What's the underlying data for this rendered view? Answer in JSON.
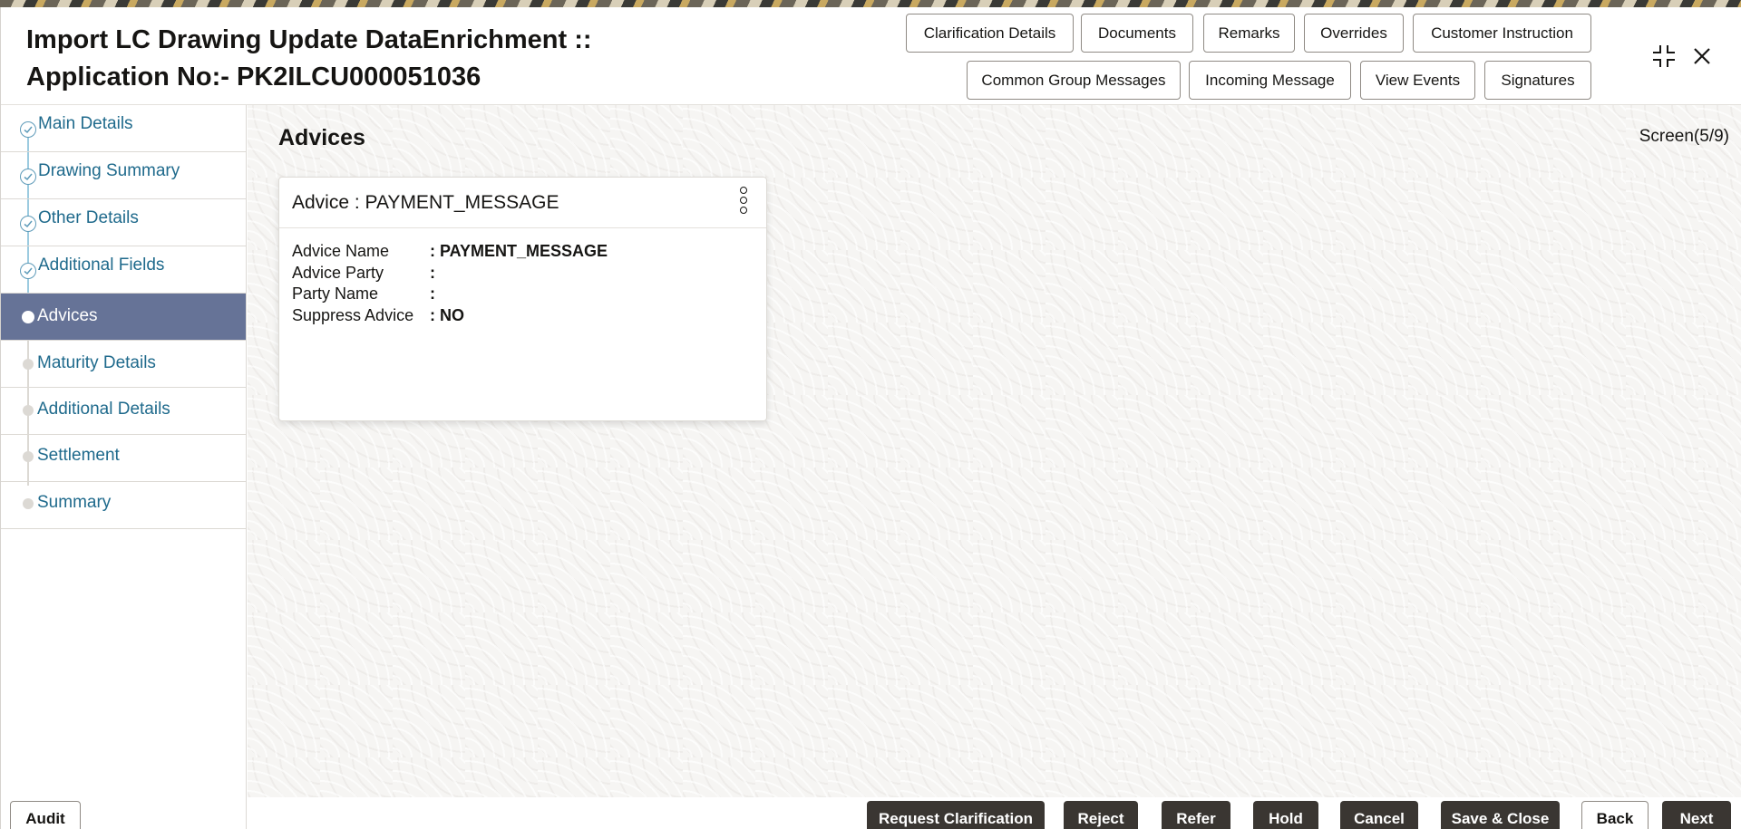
{
  "header": {
    "title_line1": "Import LC Drawing Update DataEnrichment ::",
    "title_line2": "Application No:- PK2ILCU000051036",
    "buttons_row1": [
      "Clarification Details",
      "Documents",
      "Remarks",
      "Overrides",
      "Customer Instruction"
    ],
    "buttons_row2": [
      "Common Group Messages",
      "Incoming Message",
      "View Events",
      "Signatures"
    ]
  },
  "sidebar": {
    "items": [
      {
        "label": "Main Details",
        "state": "completed"
      },
      {
        "label": "Drawing Summary",
        "state": "completed"
      },
      {
        "label": "Other Details",
        "state": "completed"
      },
      {
        "label": "Additional Fields",
        "state": "completed"
      },
      {
        "label": "Advices",
        "state": "active"
      },
      {
        "label": "Maturity Details",
        "state": "pending"
      },
      {
        "label": "Additional Details",
        "state": "pending"
      },
      {
        "label": "Settlement",
        "state": "pending"
      },
      {
        "label": "Summary",
        "state": "pending"
      }
    ]
  },
  "main": {
    "section_title": "Advices",
    "screen_indicator": "Screen(5/9)",
    "card": {
      "title": "Advice : PAYMENT_MESSAGE",
      "fields": [
        {
          "label": "Advice Name",
          "value": ": PAYMENT_MESSAGE"
        },
        {
          "label": "Advice Party",
          "value": ":"
        },
        {
          "label": "Party Name",
          "value": ":"
        },
        {
          "label": "Suppress Advice",
          "value": ": NO"
        }
      ]
    }
  },
  "footer": {
    "audit": "Audit",
    "request_clarification": "Request Clarification",
    "reject": "Reject",
    "refer": "Refer",
    "hold": "Hold",
    "cancel": "Cancel",
    "save_close": "Save & Close",
    "back": "Back",
    "next": "Next"
  },
  "colors": {
    "active_nav_bg": "#667397",
    "link_text": "#1f6a8c",
    "primary_button": "#3a3632"
  },
  "icons": {
    "collapse": "collapse-icon",
    "close": "close-icon",
    "kebab": "more-options-icon",
    "step_done": "check-circle-icon"
  }
}
